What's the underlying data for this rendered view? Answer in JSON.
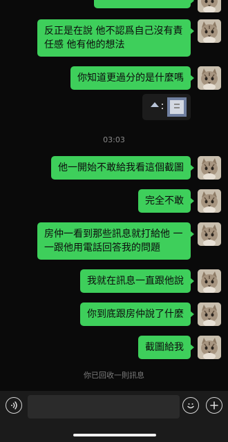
{
  "messages": [
    {
      "text": "反正是在說 他不認爲自己沒有責任感 他有他的想法"
    },
    {
      "text": "你知道更過分的是什麼嗎"
    },
    {
      "text": "他一開始不敢給我看這個截圖"
    },
    {
      "text": "完全不敢"
    },
    {
      "text": "房仲一看到那些訊息就打給他 一一跟他用電話回答我的問題"
    },
    {
      "text": "我就在訊息一直跟他說"
    },
    {
      "text": "你到底跟房仲說了什麼"
    },
    {
      "text": "截圖給我"
    }
  ],
  "timestamp": "03:03",
  "system_notice": "你已回收一則訊息",
  "colors": {
    "bubble": "#3ecf5b",
    "background": "#0a0a0a",
    "input_bar": "#1b1b1b"
  },
  "icons": {
    "voice": "voice-wave-icon",
    "emoji": "smile-icon",
    "more": "plus-icon"
  }
}
